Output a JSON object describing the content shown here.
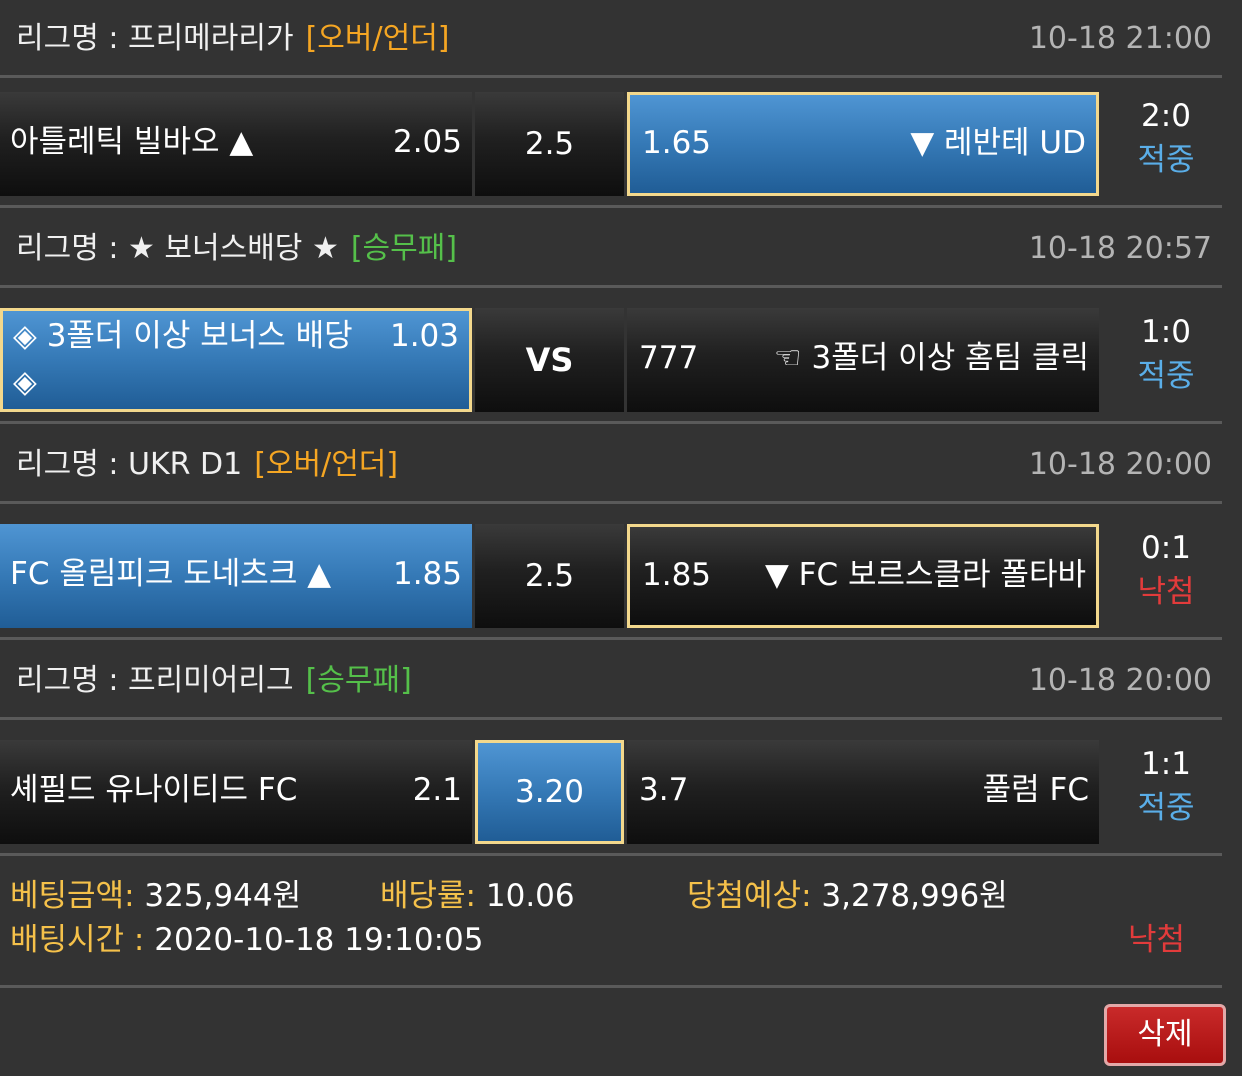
{
  "matches": [
    {
      "league_label": "리그명 : 프리메라리가",
      "bet_type": "[오버/언더]",
      "datetime": "10-18 21:00",
      "home": {
        "team": "아틀레틱 빌바오 ▲",
        "odds": "2.05"
      },
      "middle": "2.5",
      "away": {
        "odds": "1.65",
        "team": "▼ 레반테 UD"
      },
      "selected": "away",
      "score": "2:0",
      "result": "적중"
    },
    {
      "league_label": "리그명 : ★ 보너스배당 ★",
      "bet_type": "[승무패]",
      "datetime": "10-18 20:57",
      "home": {
        "team": "◈ 3폴더 이상 보너스 배당 ◈",
        "odds": "1.03"
      },
      "middle": "VS",
      "away": {
        "odds": "777",
        "team": "☜ 3폴더 이상 홈팀 클릭"
      },
      "selected": "home",
      "score": "1:0",
      "result": "적중"
    },
    {
      "league_label": "리그명 : UKR D1",
      "bet_type": "[오버/언더]",
      "datetime": "10-18 20:00",
      "home": {
        "team": "FC 올림피크 도네츠크 ▲",
        "odds": "1.85"
      },
      "middle": "2.5",
      "away": {
        "odds": "1.85",
        "team": "▼ FC 보르스클라 폴타바"
      },
      "selected": "home",
      "score": "0:1",
      "result": "낙첨"
    },
    {
      "league_label": "리그명 : 프리미어리그",
      "bet_type": "[승무패]",
      "datetime": "10-18 20:00",
      "home": {
        "team": "셰필드 유나이티드 FC",
        "odds": "2.1"
      },
      "middle": "3.20",
      "away": {
        "odds": "3.7",
        "team": "풀럼 FC"
      },
      "selected": "draw",
      "score": "1:1",
      "result": "적중"
    }
  ],
  "summary": {
    "bet_amount_label": "베팅금액:",
    "bet_amount": "325,944원",
    "odds_label": "배당률:",
    "odds": "10.06",
    "expected_label": "당첨예상:",
    "expected": "3,278,996원",
    "time_label": "배팅시간 :",
    "time": "2020-10-18 19:10:05",
    "result": "낙첨"
  },
  "delete_button": "삭제",
  "colors": {
    "background": "#333333",
    "selected_cell": "#3579b6",
    "highlight_border": "#f3d88c",
    "over_under": "#f5a623",
    "win_draw_lose": "#55c04a",
    "hit": "#5aaee8",
    "miss": "#e23b3b",
    "label_gold": "#f5c14a",
    "delete_button": "#b81b1b"
  }
}
